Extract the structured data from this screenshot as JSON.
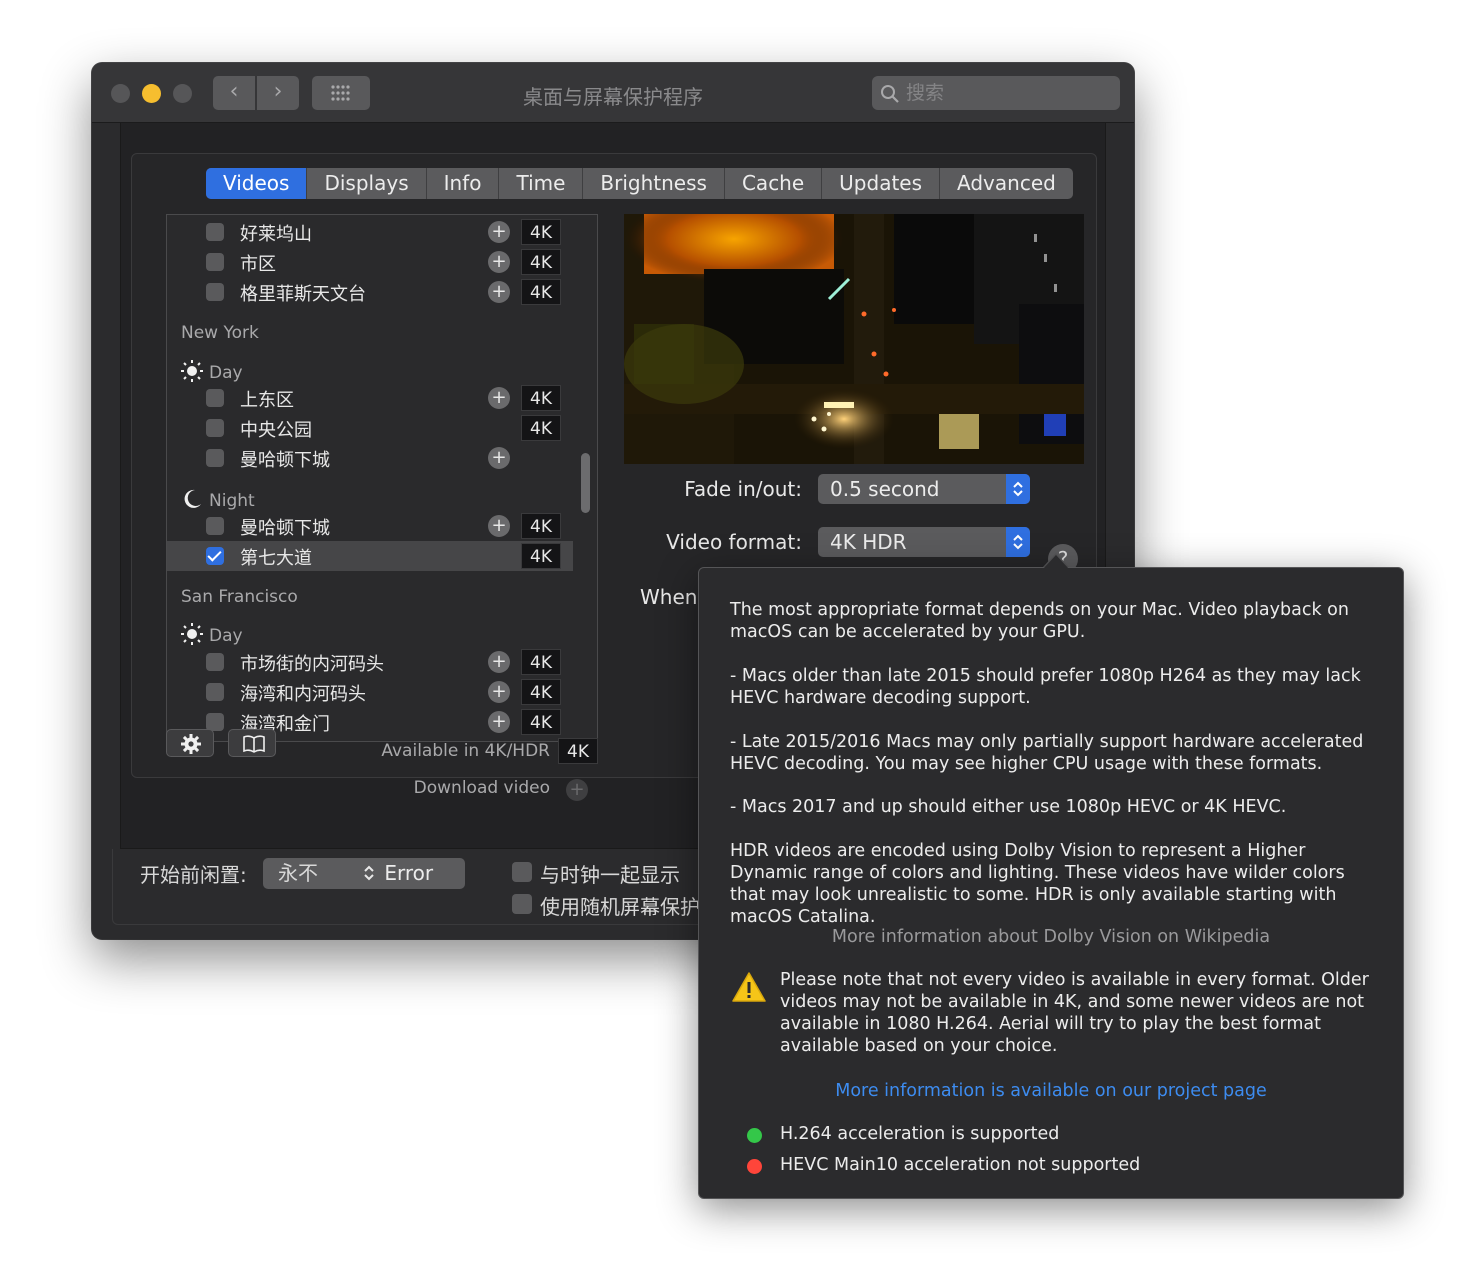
{
  "window": {
    "title": "桌面与屏幕保护程序",
    "search_placeholder": "搜索"
  },
  "tabs": [
    {
      "label": "Videos",
      "active": true
    },
    {
      "label": "Displays",
      "active": false
    },
    {
      "label": "Info",
      "active": false
    },
    {
      "label": "Time",
      "active": false
    },
    {
      "label": "Brightness",
      "active": false
    },
    {
      "label": "Cache",
      "active": false
    },
    {
      "label": "Updates",
      "active": false
    },
    {
      "label": "Advanced",
      "active": false
    }
  ],
  "list": {
    "top_items": [
      {
        "label": "好莱坞山",
        "checked": false,
        "plus": true,
        "badge": "4K"
      },
      {
        "label": "市区",
        "checked": false,
        "plus": true,
        "badge": "4K"
      },
      {
        "label": "格里菲斯天文台",
        "checked": false,
        "plus": true,
        "badge": "4K"
      }
    ],
    "ny": {
      "title": "New York",
      "day_label": "Day",
      "day_items": [
        {
          "label": "上东区",
          "checked": false,
          "plus": true,
          "badge": "4K"
        },
        {
          "label": "中央公园",
          "checked": false,
          "plus": false,
          "badge": "4K"
        },
        {
          "label": "曼哈顿下城",
          "checked": false,
          "plus": true,
          "badge": ""
        }
      ],
      "night_label": "Night",
      "night_items": [
        {
          "label": "曼哈顿下城",
          "checked": false,
          "plus": true,
          "badge": "4K"
        },
        {
          "label": "第七大道",
          "checked": true,
          "plus": false,
          "badge": "4K"
        }
      ]
    },
    "sf": {
      "title": "San Francisco",
      "day_label": "Day",
      "day_items": [
        {
          "label": "市场街的内河码头",
          "checked": false,
          "plus": true,
          "badge": "4K"
        },
        {
          "label": "海湾和内河码头",
          "checked": false,
          "plus": true,
          "badge": "4K"
        },
        {
          "label": "海湾和金门",
          "checked": false,
          "plus": true,
          "badge": "4K"
        }
      ]
    }
  },
  "legend": {
    "available_label": "Available in 4K/HDR",
    "available_badge": "4K",
    "download_label": "Download video",
    "download_plus": "+"
  },
  "settings": {
    "fade_label": "Fade in/out:",
    "fade_value": "0.5 second",
    "format_label": "Video format:",
    "format_value": "4K HDR",
    "help": "?",
    "when_label": "When c"
  },
  "show_error": {
    "label": "Show Error",
    "x": "✕"
  },
  "bottom": {
    "idle_label": "开始前闲置:",
    "idle_value": "永不",
    "opt1": "与时钟一起显示",
    "opt2": "使用随机屏幕保护"
  },
  "popover": {
    "p1": "The most appropriate format depends on your Mac. Video playback on macOS can be accelerated by your GPU.",
    "p2": "- Macs older than late 2015 should prefer 1080p H264 as they may lack HEVC hardware decoding support.",
    "p3": "- Late 2015/2016 Macs may only partially support hardware accelerated HEVC decoding. You may see higher CPU usage with these formats.",
    "p4": "- Macs 2017 and up should either use 1080p HEVC or 4K HEVC.",
    "p5": "HDR videos are encoded using Dolby Vision to represent a Higher Dynamic range of colors and lighting. These videos have wilder colors that may look unrealistic to some. HDR is only available starting with macOS Catalina.",
    "dolby_link": "More information about Dolby Vision on Wikipedia",
    "warning": "Please note that not every video is available in every format. Older videos may not be available in 4K, and some newer videos are not available in 1080 H.264. Aerial will try to play the best format available based on your choice.",
    "project_link": "More information is available on our project page",
    "status1": "H.264 acceleration is supported",
    "status1_color": "#34c749",
    "status2": "HEVC Main10 acceleration not supported",
    "status2_color": "#ff453a"
  },
  "colors": {
    "accent": "#2f6fe0",
    "link": "#3d8cf0",
    "muted_link": "#9a9a9c"
  }
}
